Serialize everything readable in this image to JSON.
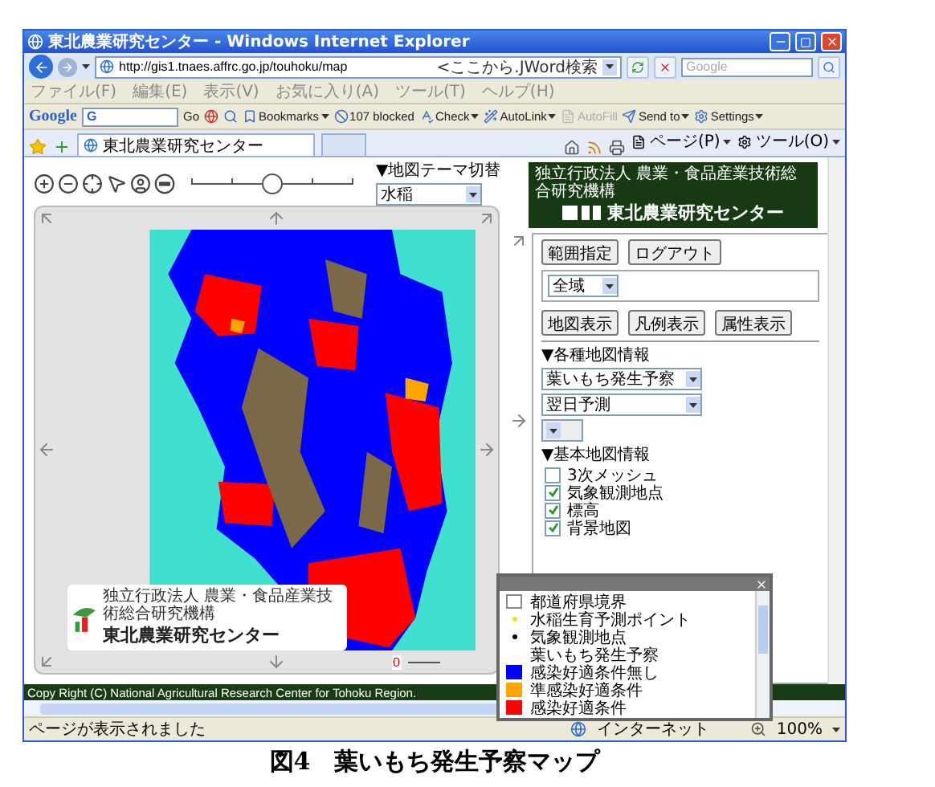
{
  "window": {
    "title": "東北農業研究センター - Windows Internet Explorer"
  },
  "address_bar": {
    "url": "http://gis1.tnaes.affrc.go.jp/touhoku/map",
    "search_provider": "<ここから.JWord検索",
    "search_placeholder": "Google"
  },
  "menu": [
    "ファイル(F)",
    "編集(E)",
    "表示(V)",
    "お気に入り(A)",
    "ツール(T)",
    "ヘルプ(H)"
  ],
  "google_toolbar": {
    "logo": "Google",
    "search_label": "G",
    "go": "Go",
    "items": [
      {
        "label": "Bookmarks",
        "dropdown": true,
        "disabled": false
      },
      {
        "label": "107 blocked",
        "dropdown": false,
        "disabled": false
      },
      {
        "label": "Check",
        "dropdown": true,
        "disabled": false
      },
      {
        "label": "AutoLink",
        "dropdown": true,
        "disabled": false
      },
      {
        "label": "AutoFill",
        "dropdown": false,
        "disabled": true
      },
      {
        "label": "Send to",
        "dropdown": true,
        "disabled": false
      },
      {
        "label": "Settings",
        "dropdown": true,
        "disabled": false
      }
    ]
  },
  "tabs": [
    {
      "label": "東北農業研究センター",
      "selected": true
    }
  ],
  "command_bar": [
    "ページ(P)",
    "ツール(O)"
  ],
  "map_tools": {
    "slider": {
      "level": 0.49
    },
    "theme": {
      "label": "▼地図テーマ切替",
      "value": "水稲"
    }
  },
  "map": {
    "scale_label": "0",
    "logo": {
      "org": "独立行政法人 農業・食品産業技術総合研究機構",
      "name": "東北農業研究センター"
    }
  },
  "header_logo": {
    "org": "独立行政法人 農業・食品産業技術総合研究機構",
    "name": "東北農業研究センター"
  },
  "panel": {
    "top_buttons": [
      "範囲指定",
      "ログアウト"
    ],
    "area": "全域",
    "view_buttons": [
      "地図表示",
      "凡例表示",
      "属性表示"
    ],
    "layers": {
      "title": "▼各種地図情報",
      "selects": [
        {
          "value": "葉いもち発生予察",
          "disabled": false
        },
        {
          "value": "翌日予測",
          "disabled": false
        },
        {
          "disabled": true
        }
      ]
    },
    "base_layers": {
      "title": "▼基本地図情報",
      "items": [
        {
          "label": "3次メッシュ",
          "checked": false
        },
        {
          "label": "気象観測地点",
          "checked": true
        },
        {
          "label": "標高",
          "checked": true
        },
        {
          "label": "背景地図",
          "checked": true
        }
      ]
    }
  },
  "legend": {
    "items": [
      {
        "kind": "outline",
        "label": "都道府県境界",
        "color": "#ffffff"
      },
      {
        "kind": "dot",
        "label": "水稲生育予測ポイント",
        "color": "#e8e800"
      },
      {
        "kind": "dot",
        "label": "気象観測地点",
        "color": "#000000"
      },
      {
        "kind": "heading",
        "label": "葉いもち発生予察"
      },
      {
        "kind": "swatch",
        "label": "感染好適条件無し",
        "color": "#0000ff"
      },
      {
        "kind": "swatch",
        "label": "準感染好適条件",
        "color": "#ffa500"
      },
      {
        "kind": "swatch",
        "label": "感染好適条件",
        "color": "#ff0000"
      }
    ]
  },
  "copyright": "Copy Right (C) National Agricultural Research Center for Tohoku Region.",
  "status_bar": {
    "text": "ページが表示されました",
    "zone": "インターネット",
    "zoom": "100%"
  },
  "caption": "図4　葉いもち発生予察マップ"
}
